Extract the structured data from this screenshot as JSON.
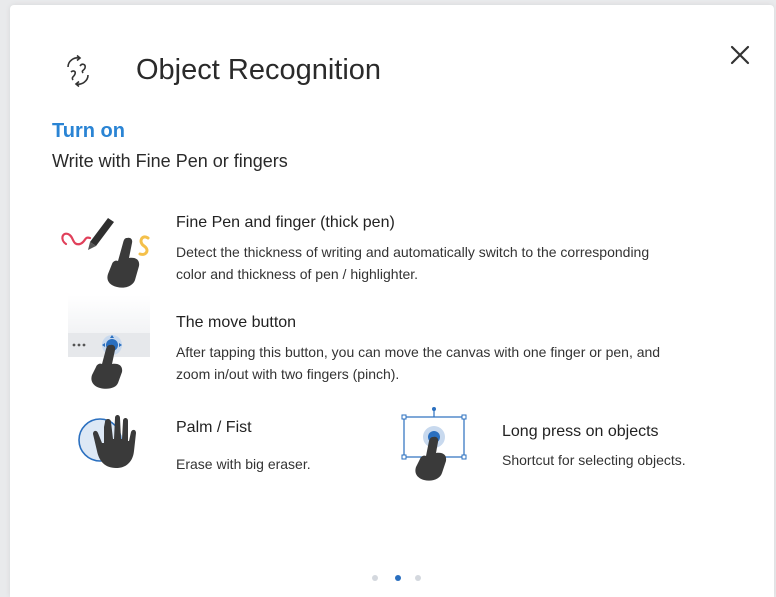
{
  "header": {
    "title": "Object Recognition",
    "icon": "object-recognition-icon",
    "close_icon": "close-icon"
  },
  "turn_on_label": "Turn on",
  "subtitle": "Write with Fine Pen or fingers",
  "features": [
    {
      "title": "Fine Pen and finger (thick pen)",
      "desc_line1": "Detect the thickness of writing and automatically switch to the corresponding",
      "desc_line2": "color and thickness of pen / highlighter.",
      "icon": "pen-and-finger-icon"
    },
    {
      "title": "The move button",
      "desc_line1": "After tapping this button, you can move the canvas with one finger or pen, and",
      "desc_line2": "zoom in/out with two fingers (pinch).",
      "icon": "move-button-icon"
    },
    {
      "title": "Palm / Fist",
      "desc_line1": "Erase with big eraser.",
      "icon": "palm-icon"
    },
    {
      "title": "Long press on objects",
      "desc_line1": "Shortcut for selecting objects.",
      "icon": "long-press-icon"
    }
  ],
  "pagination": {
    "pages": 3,
    "active": 2
  },
  "colors": {
    "accent": "#2a84d4",
    "text": "#2a2a2a",
    "pen_red": "#e0405a",
    "highlight_yellow": "#f4c04a",
    "hand_dark": "#3a3a3a",
    "dot_active": "#2a6fbf",
    "dot_inactive": "#d4d8de"
  }
}
